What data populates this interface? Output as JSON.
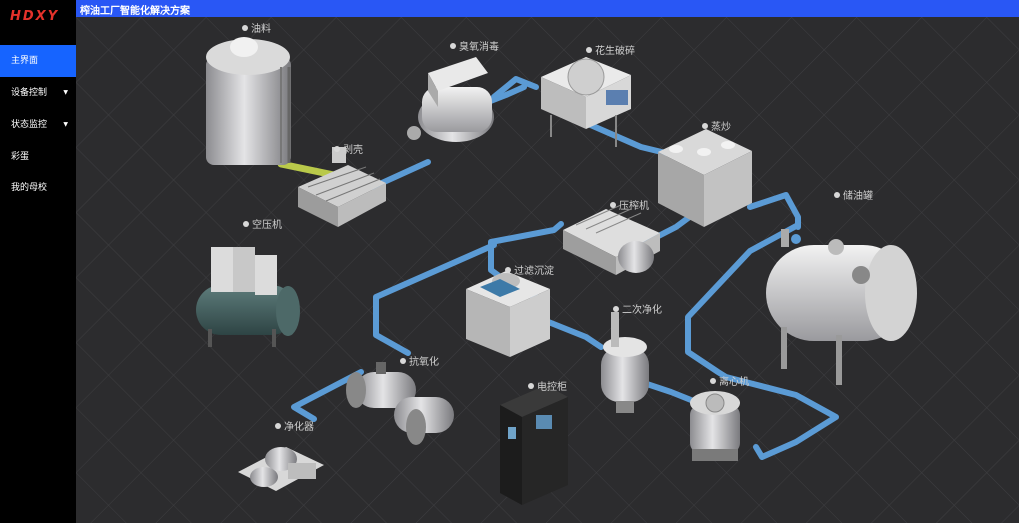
{
  "brand": {
    "logo_text": "HDXY",
    "logo_color": "#e4322b"
  },
  "header": {
    "title": "榨油工厂智能化解决方案",
    "bar_color": "#2957f5"
  },
  "sidebar": {
    "active_color": "#1664ff",
    "items": [
      {
        "label": "主界面",
        "active": true,
        "has_submenu": false
      },
      {
        "label": "设备控制",
        "active": false,
        "has_submenu": true
      },
      {
        "label": "状态监控",
        "active": false,
        "has_submenu": true
      },
      {
        "label": "彩蛋",
        "active": false,
        "has_submenu": false
      },
      {
        "label": "我的母校",
        "active": false,
        "has_submenu": false
      }
    ],
    "submenu_icon": "caret-down-icon"
  },
  "scene": {
    "pipe_color": "#5b9bd5",
    "equipment": [
      {
        "id": "oil-tank",
        "label": "油料"
      },
      {
        "id": "ozone",
        "label": "臭氧消毒"
      },
      {
        "id": "peanut-crusher",
        "label": "花生破碎"
      },
      {
        "id": "peeling",
        "label": "剥壳"
      },
      {
        "id": "roaster",
        "label": "蒸炒"
      },
      {
        "id": "storage-tank",
        "label": "储油罐"
      },
      {
        "id": "press",
        "label": "压榨机"
      },
      {
        "id": "air-compressor",
        "label": "空压机"
      },
      {
        "id": "filter",
        "label": "过滤沉淀"
      },
      {
        "id": "secondary-purify",
        "label": "二次净化"
      },
      {
        "id": "antioxidant",
        "label": "抗氧化"
      },
      {
        "id": "control-cabinet",
        "label": "电控柜"
      },
      {
        "id": "centrifuge",
        "label": "离心机"
      },
      {
        "id": "purifier",
        "label": "净化器"
      }
    ]
  }
}
